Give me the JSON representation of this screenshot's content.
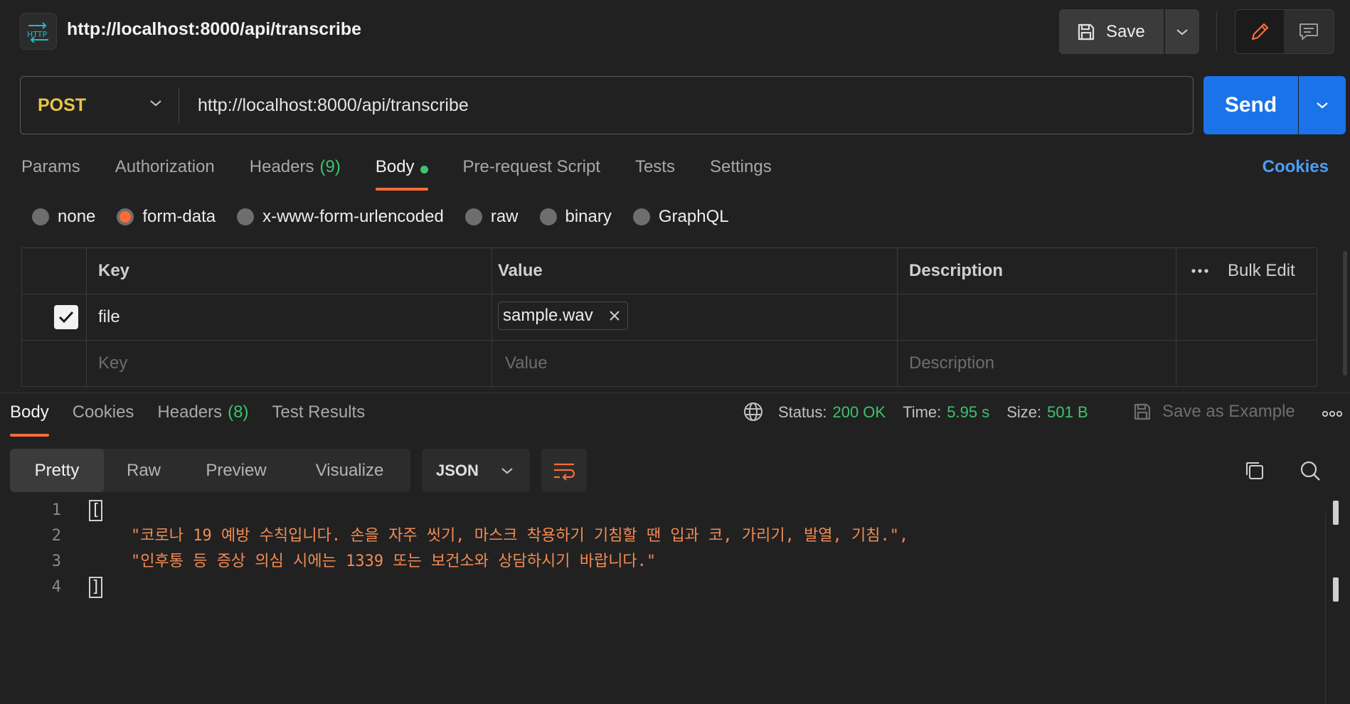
{
  "header": {
    "icon_label": "HTTP",
    "title": "http://localhost:8000/api/transcribe",
    "save_label": "Save"
  },
  "request": {
    "method": "POST",
    "url": "http://localhost:8000/api/transcribe",
    "send_label": "Send"
  },
  "req_tabs": {
    "params": "Params",
    "authorization": "Authorization",
    "headers": "Headers",
    "headers_count": "(9)",
    "body": "Body",
    "prerequest": "Pre-request Script",
    "tests": "Tests",
    "settings": "Settings",
    "cookies": "Cookies"
  },
  "body_types": {
    "none": "none",
    "form_data": "form-data",
    "urlencoded": "x-www-form-urlencoded",
    "raw": "raw",
    "binary": "binary",
    "graphql": "GraphQL",
    "selected": "form-data"
  },
  "params_table": {
    "headers": {
      "key": "Key",
      "value": "Value",
      "description": "Description",
      "bulk_edit": "Bulk Edit"
    },
    "rows": [
      {
        "checked": true,
        "key": "file",
        "value": "sample.wav",
        "description": ""
      }
    ],
    "placeholders": {
      "key": "Key",
      "value": "Value",
      "description": "Description"
    }
  },
  "response": {
    "tabs": {
      "body": "Body",
      "cookies": "Cookies",
      "headers": "Headers",
      "headers_count": "(8)",
      "test_results": "Test Results"
    },
    "status_label": "Status:",
    "status": "200 OK",
    "time_label": "Time:",
    "time": "5.95 s",
    "size_label": "Size:",
    "size": "501 B",
    "save_example": "Save as Example",
    "view_tabs": {
      "pretty": "Pretty",
      "raw": "Raw",
      "preview": "Preview",
      "visualize": "Visualize"
    },
    "format": "JSON",
    "lines": [
      {
        "num": "1",
        "text": "["
      },
      {
        "num": "2",
        "text": "\"코로나 19 예방 수칙입니다. 손을 자주 씻기, 마스크 착용하기 기침할 땐 입과 코, 가리기, 발열, 기침.\","
      },
      {
        "num": "3",
        "text": "\"인후통 등 증상 의심 시에는 1339 또는 보건소와 상담하시기 바랍니다.\""
      },
      {
        "num": "4",
        "text": "]"
      }
    ]
  },
  "colors": {
    "accent": "#ff6c37",
    "send": "#1a73e8",
    "success": "#3ec36d",
    "method": "#e8c547",
    "string": "#f28b54"
  }
}
